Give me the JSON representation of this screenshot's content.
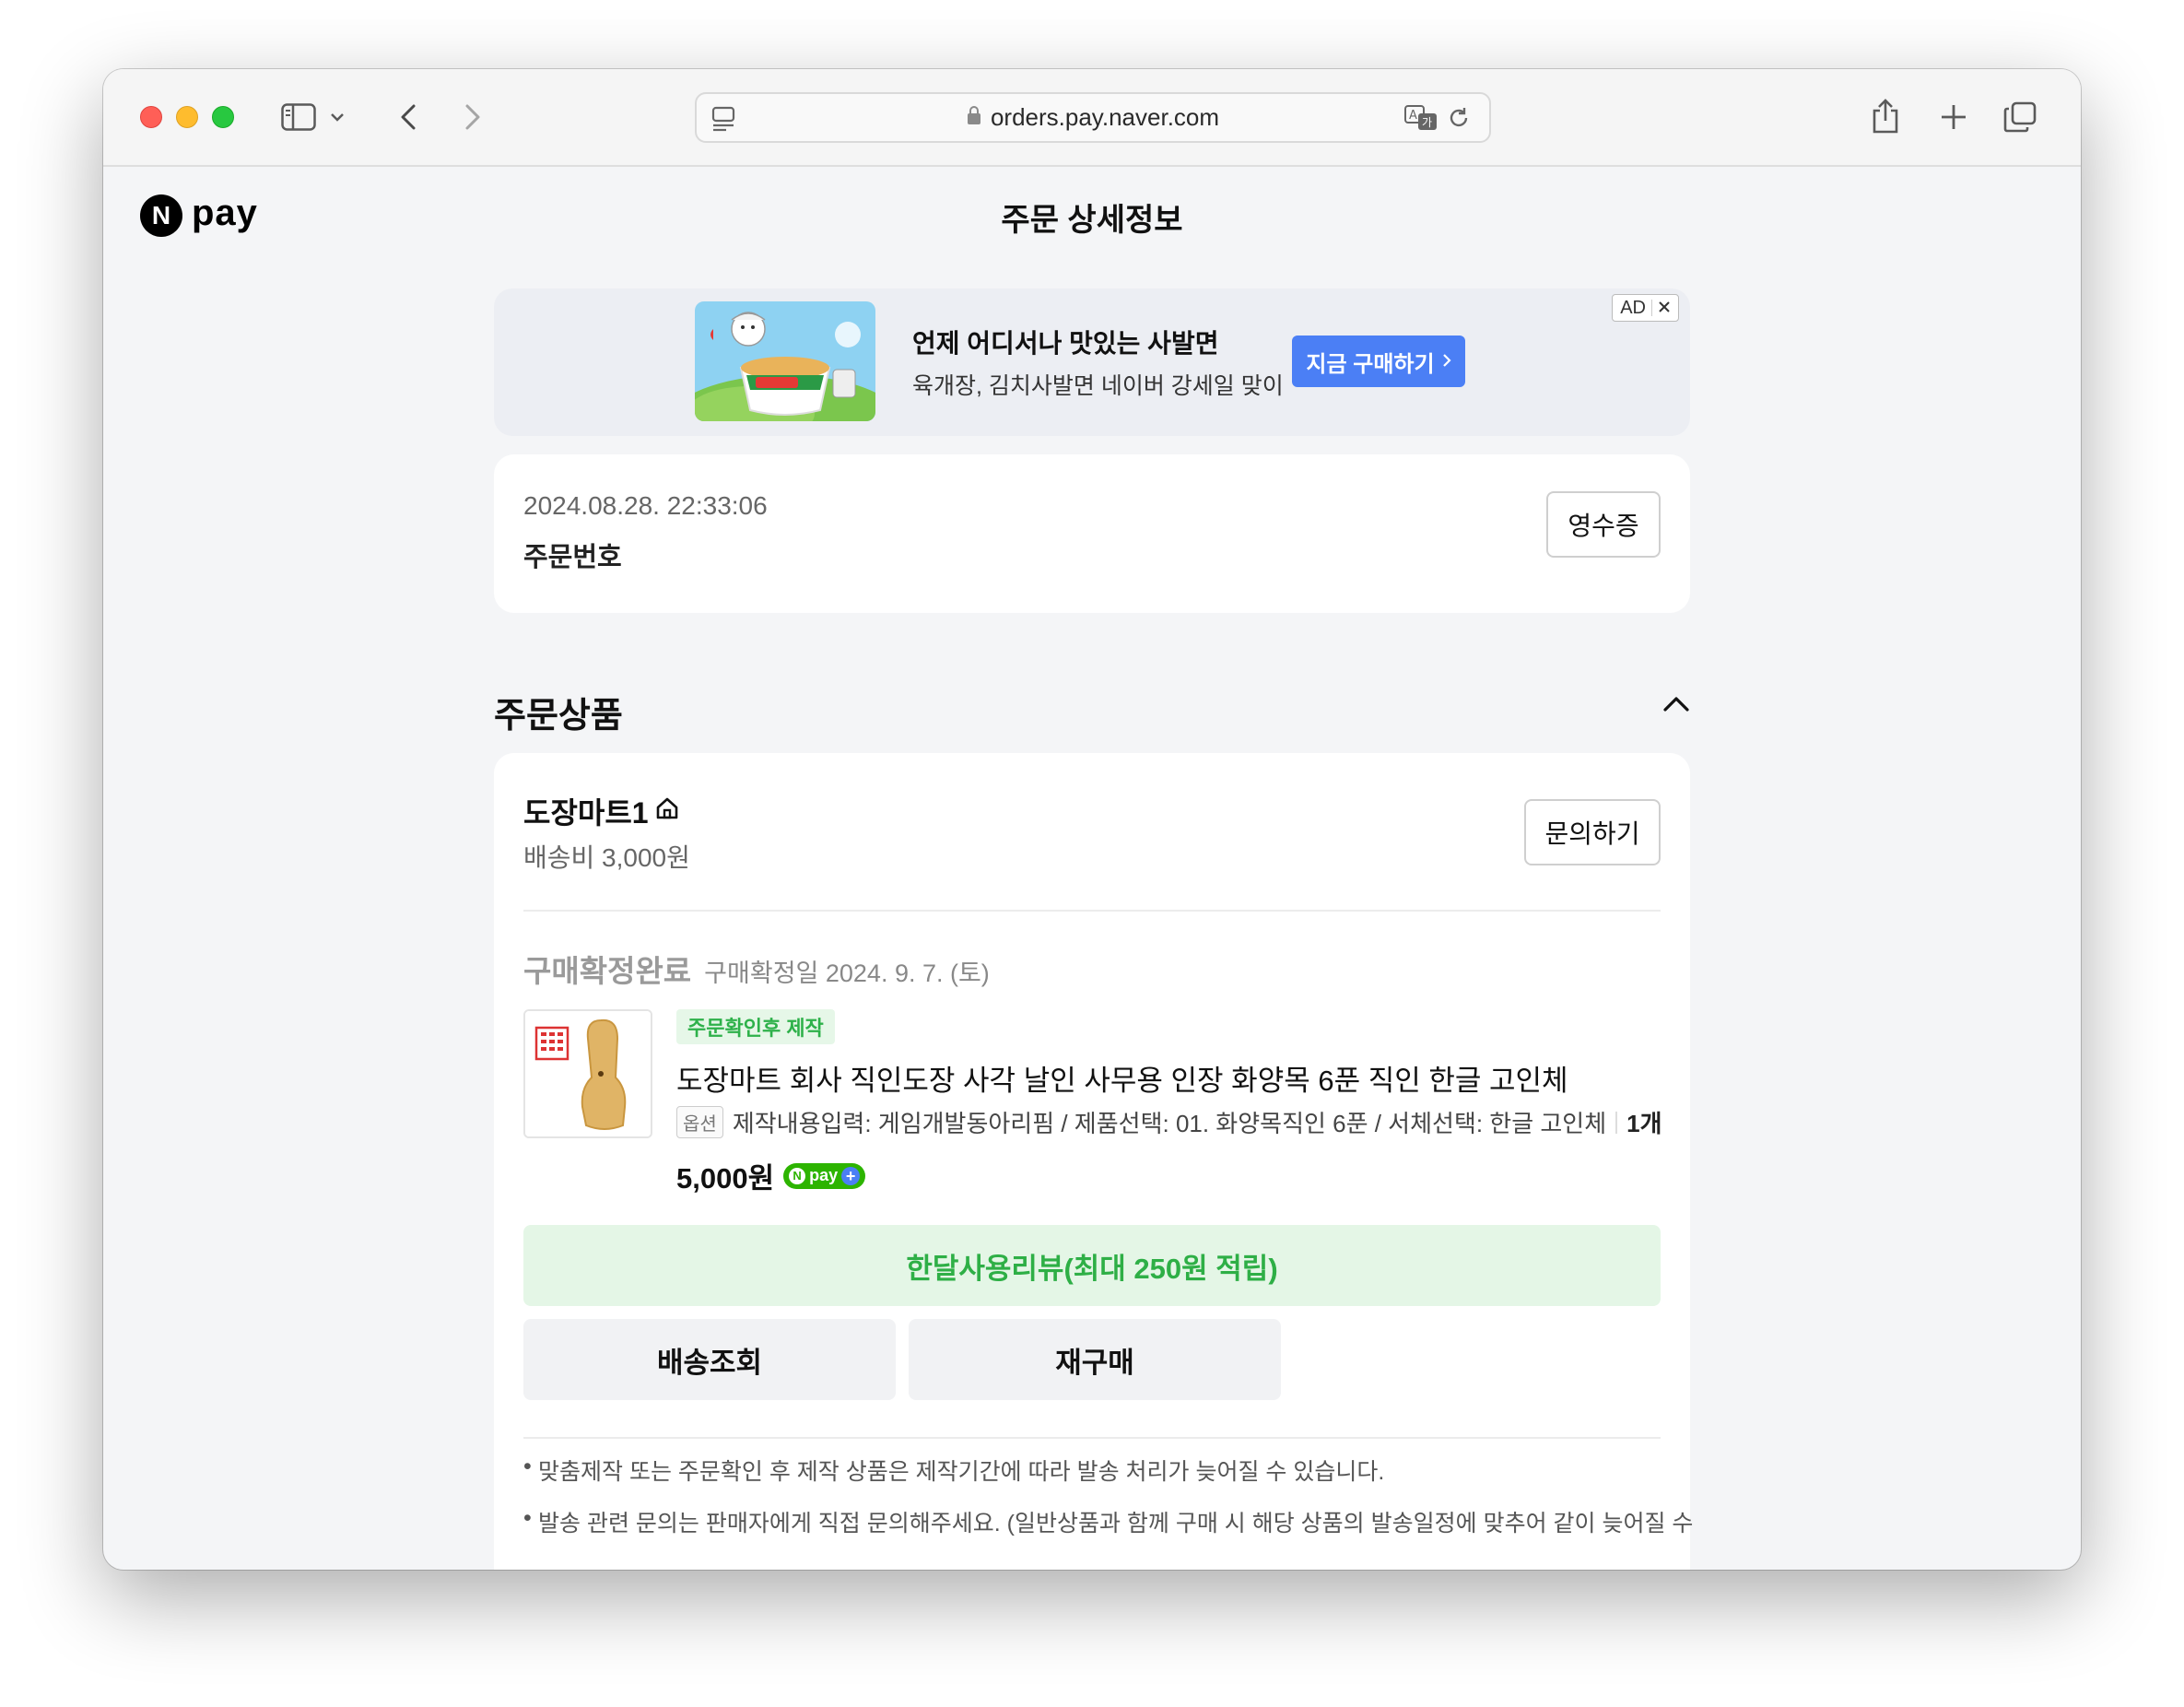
{
  "browser": {
    "url": "orders.pay.naver.com"
  },
  "header": {
    "logo_text": "pay",
    "logo_mark": "N",
    "title": "주문 상세정보"
  },
  "ad": {
    "title": "언제 어디서나 맛있는 사발면",
    "subtitle": "육개장, 김치사발면 네이버 강세일 맞이",
    "cta": "지금 구매하기",
    "badge": "AD"
  },
  "order": {
    "datetime": "2024.08.28. 22:33:06",
    "number_label": "주문번호",
    "receipt_button": "영수증"
  },
  "products_section": {
    "title": "주문상품"
  },
  "store": {
    "name": "도장마트1",
    "shipping": "배송비 3,000원",
    "inquiry_button": "문의하기"
  },
  "item": {
    "status": "구매확정완료",
    "status_date": "구매확정일 2024. 9. 7. (토)",
    "tag": "주문확인후 제작",
    "name": "도장마트 회사 직인도장 사각 날인 사무용 인장 화양목 6푼 직인 한글 고인체",
    "option_badge": "옵션",
    "option_text": "제작내용입력: 게임개발동아리핌 / 제품선택: 01. 화양목직인 6푼 / 서체선택: 한글 고인체",
    "quantity": "1개",
    "price": "5,000원",
    "npay_badge": "pay"
  },
  "actions": {
    "review": "한달사용리뷰(최대 250원 적립)",
    "tracking": "배송조회",
    "rebuy": "재구매"
  },
  "notes": [
    "맞춤제작 또는 주문확인 후 제작 상품은 제작기간에 따라 발송 처리가 늦어질 수 있습니다.",
    "발송 관련 문의는 판매자에게 직접 문의해주세요. (일반상품과 함께 구매 시 해당 상품의 발송일정에 맞추어 같이 늦어질 수"
  ],
  "colors": {
    "accent_blue": "#4b7ff5",
    "npay_green": "#2db400",
    "review_green": "#2eaf46"
  }
}
